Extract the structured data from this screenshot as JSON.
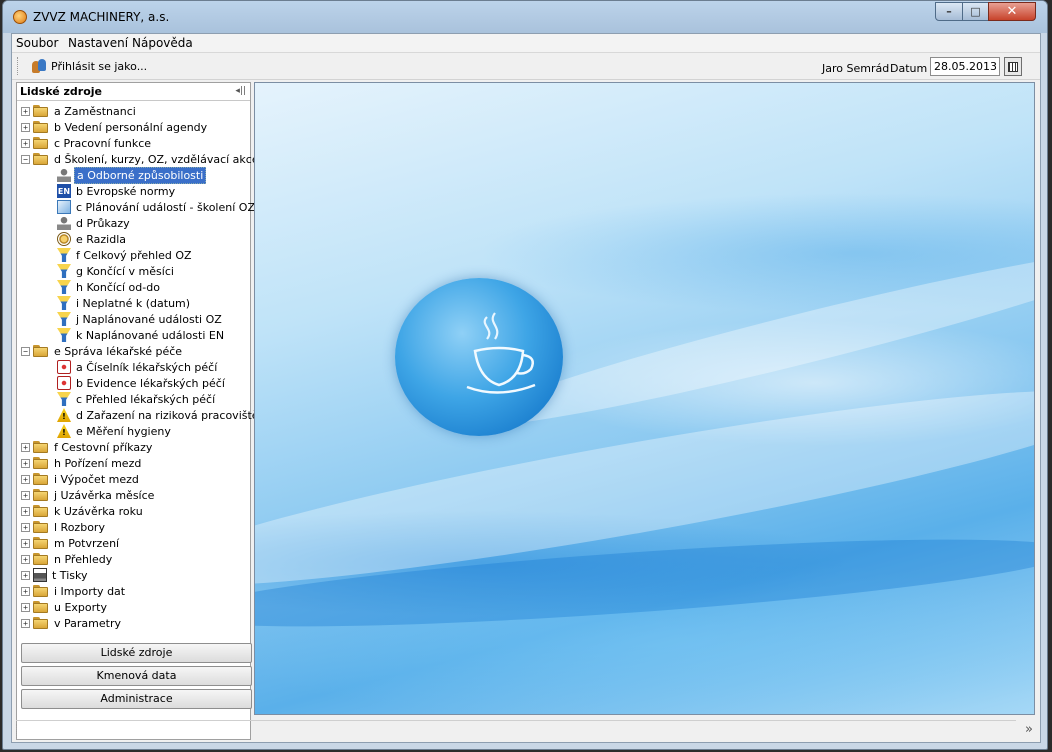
{
  "window": {
    "title": "ZVVZ MACHINERY, a.s.",
    "minimize": "–",
    "maximize": "□",
    "close": "✕"
  },
  "menu": [
    "Soubor",
    "Nastavení",
    "Nápověda"
  ],
  "toolbar": {
    "login_label": "Přihlásit se jako...",
    "user_name": "Jaro Semrád",
    "date_label": "Datum",
    "date_value": "28.05.2013"
  },
  "panel": {
    "title": "Lidské zdroje",
    "collapse_icon": "◂||"
  },
  "tree": [
    {
      "label": "a Zaměstnanci",
      "level": 0,
      "expander": "+",
      "icon": "folder"
    },
    {
      "label": "b Vedení personální agendy",
      "level": 0,
      "expander": "+",
      "icon": "folder"
    },
    {
      "label": "c Pracovní funkce",
      "level": 0,
      "expander": "+",
      "icon": "folder"
    },
    {
      "label": "d Školení, kurzy, OZ, vzdělávací akce",
      "level": 0,
      "expander": "−",
      "icon": "folder"
    },
    {
      "label": "a Odborné způsobilosti",
      "level": 1,
      "icon": "person",
      "selected": true
    },
    {
      "label": "b Evropské normy",
      "level": 1,
      "icon": "en"
    },
    {
      "label": "c Plánování událostí - školení OZ",
      "level": 1,
      "icon": "plan"
    },
    {
      "label": "d Průkazy",
      "level": 1,
      "icon": "person"
    },
    {
      "label": "e Razidla",
      "level": 1,
      "icon": "stamp"
    },
    {
      "label": "f Celkový přehled OZ",
      "level": 1,
      "icon": "funnel"
    },
    {
      "label": "g Končící v měsíci",
      "level": 1,
      "icon": "funnel"
    },
    {
      "label": "h Končící od-do",
      "level": 1,
      "icon": "funnel"
    },
    {
      "label": "i Neplatné k (datum)",
      "level": 1,
      "icon": "funnel"
    },
    {
      "label": "j Naplánované události OZ",
      "level": 1,
      "icon": "funnel"
    },
    {
      "label": "k Naplánované události EN",
      "level": 1,
      "icon": "funnel"
    },
    {
      "label": "e Správa lékařské péče",
      "level": 0,
      "expander": "−",
      "icon": "folder"
    },
    {
      "label": "a Číselník lékařských péčí",
      "level": 1,
      "icon": "med"
    },
    {
      "label": "b Evidence lékařských péčí",
      "level": 1,
      "icon": "med"
    },
    {
      "label": "c Přehled lékařských péčí",
      "level": 1,
      "icon": "funnel"
    },
    {
      "label": "d Zařazení na riziková pracoviště",
      "level": 1,
      "icon": "warn"
    },
    {
      "label": "e Měření hygieny",
      "level": 1,
      "icon": "warn"
    },
    {
      "label": "f Cestovní příkazy",
      "level": 0,
      "expander": "+",
      "icon": "folder"
    },
    {
      "label": "h Pořízení mezd",
      "level": 0,
      "expander": "+",
      "icon": "folder"
    },
    {
      "label": "i Výpočet mezd",
      "level": 0,
      "expander": "+",
      "icon": "folder"
    },
    {
      "label": "j Uzávěrka měsíce",
      "level": 0,
      "expander": "+",
      "icon": "folder"
    },
    {
      "label": "k Uzávěrka roku",
      "level": 0,
      "expander": "+",
      "icon": "folder"
    },
    {
      "label": "l Rozbory",
      "level": 0,
      "expander": "+",
      "icon": "folder"
    },
    {
      "label": "m Potvrzení",
      "level": 0,
      "expander": "+",
      "icon": "folder"
    },
    {
      "label": "n Přehledy",
      "level": 0,
      "expander": "+",
      "icon": "folder"
    },
    {
      "label": "t Tisky",
      "level": 0,
      "expander": "+",
      "icon": "printer"
    },
    {
      "label": "i Importy dat",
      "level": 0,
      "expander": "+",
      "icon": "folder"
    },
    {
      "label": "u Exporty",
      "level": 0,
      "expander": "+",
      "icon": "folder"
    },
    {
      "label": "v Parametry",
      "level": 0,
      "expander": "+",
      "icon": "folder"
    }
  ],
  "nav_buttons": [
    "Lidské zdroje",
    "Kmenová data",
    "Administrace"
  ],
  "status": {
    "expand_icon": "»"
  },
  "colors": {
    "selection": "#3a6fc9",
    "workspace_blue": "#5ab0ea"
  }
}
